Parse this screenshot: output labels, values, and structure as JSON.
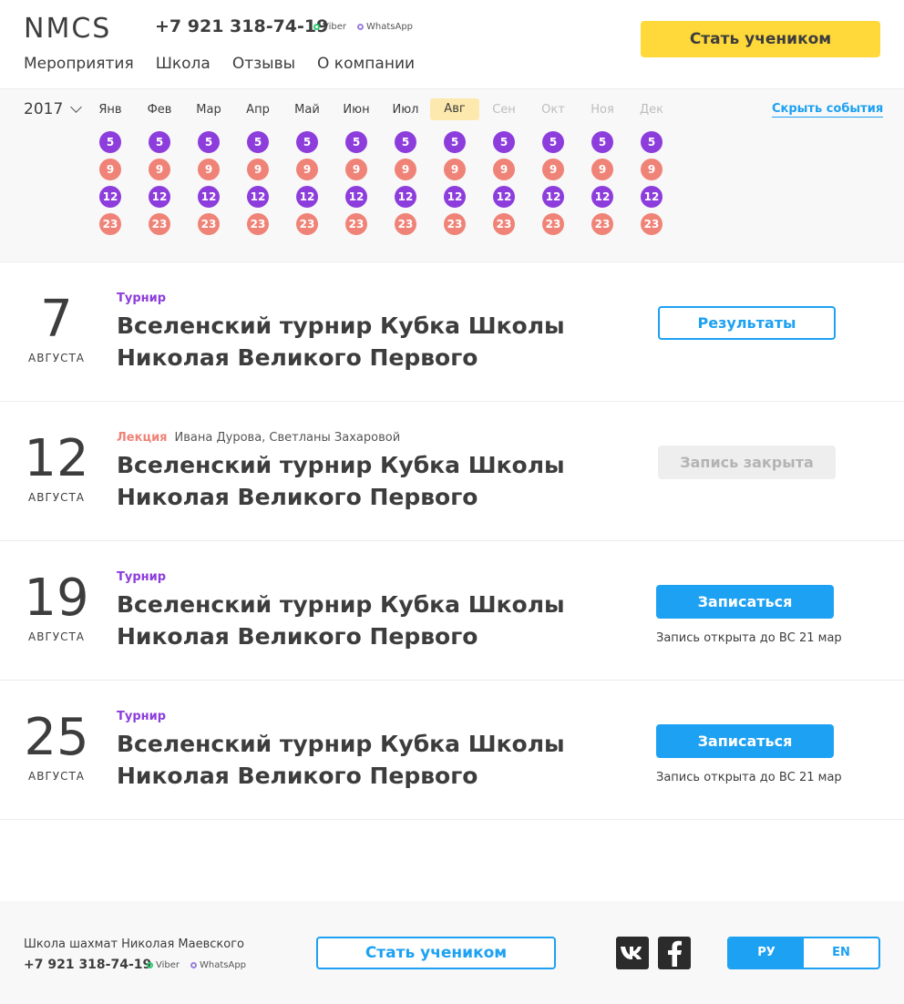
{
  "header": {
    "logo": "NMCS",
    "phone": "+7 921 318-74-19",
    "viber": "Viber",
    "whatsapp": "WhatsApp",
    "nav": [
      "Мероприятия",
      "Школа",
      "Отзывы",
      "О компании"
    ],
    "cta": "Стать учеником"
  },
  "calendar": {
    "year": "2017",
    "hide_link": "Скрыть события",
    "current_month_index": 7,
    "months": [
      "Янв",
      "Фев",
      "Мар",
      "Апр",
      "Май",
      "Июн",
      "Июл",
      "Авг",
      "Сен",
      "Окт",
      "Ноя",
      "Дек"
    ],
    "days": [
      {
        "label": "5",
        "color": "#8d3ddc"
      },
      {
        "label": "9",
        "color": "#f08378"
      },
      {
        "label": "12",
        "color": "#8d3ddc"
      },
      {
        "label": "23",
        "color": "#f08378"
      }
    ]
  },
  "events": [
    {
      "day": "7",
      "month": "АВГУСТА",
      "tag": "Турнир",
      "speakers": "",
      "title": "Вселенский турнир Кубка Школы Николая Великого Первого",
      "action": "Результаты",
      "note": ""
    },
    {
      "day": "12",
      "month": "АВГУСТА",
      "tag": "Лекция",
      "speakers": "Ивана Дурова, Светланы Захаровой",
      "title": "Вселенский турнир Кубка Школы Николая Великого Первого",
      "action": "Запись закрыта",
      "note": ""
    },
    {
      "day": "19",
      "month": "АВГУСТА",
      "tag": "Турнир",
      "speakers": "",
      "title": "Вселенский турнир Кубка Школы Николая Великого Первого",
      "action": "Записаться",
      "note": "Запись открыта до ВС 21 мар"
    },
    {
      "day": "25",
      "month": "АВГУСТА",
      "tag": "Турнир",
      "speakers": "",
      "title": "Вселенский турнир Кубка Школы Николая Великого Первого",
      "action": "Записаться",
      "note": "Запись открыта до ВС 21 мар"
    }
  ],
  "footer": {
    "school": "Школа шахмат Николая Маевского",
    "phone": "+7 921 318-74-19",
    "viber": "Viber",
    "whatsapp": "WhatsApp",
    "cta": "Стать учеником",
    "social": [
      "vk-icon",
      "facebook-icon"
    ],
    "lang_ru": "РУ",
    "lang_en": "EN"
  },
  "colors": {
    "accent_blue": "#1da1f2",
    "accent_yellow": "#ffd83a",
    "purple": "#8d3ddc",
    "salmon": "#f08378"
  }
}
